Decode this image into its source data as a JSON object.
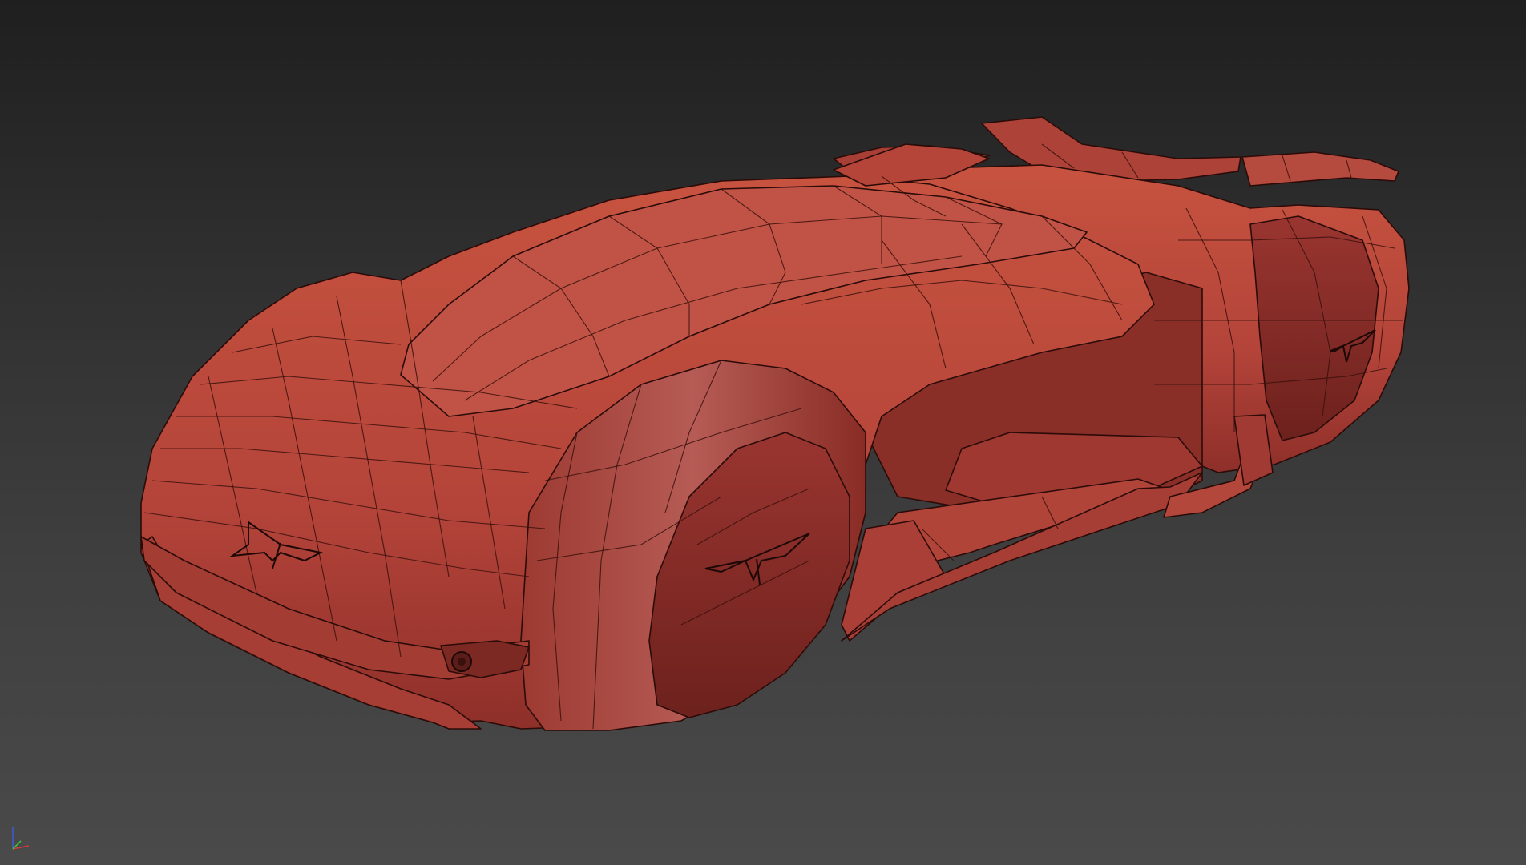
{
  "viewport": {
    "background_top": "#1f1f1f",
    "background_bottom": "#4a4a4a",
    "model_color": "#b8463a",
    "wire_color": "#3a100c",
    "axis_gizmo": {
      "x_color": "#d23b3b",
      "y_color": "#3bc23b",
      "z_color": "#3b5bd2"
    }
  }
}
